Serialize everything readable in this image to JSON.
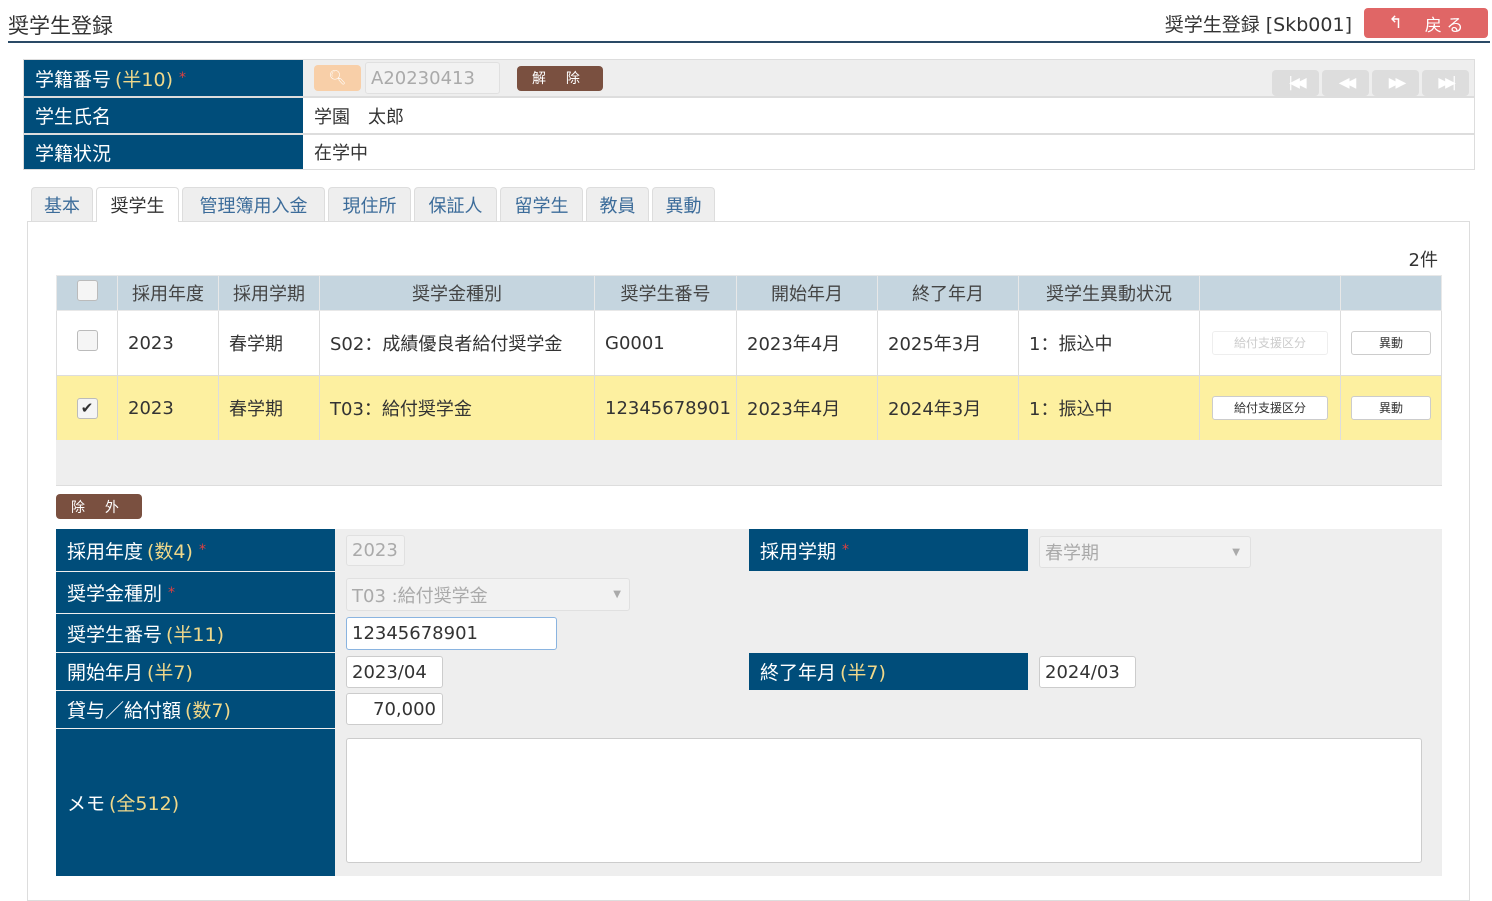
{
  "header": {
    "title": "奨学生登録",
    "screen_id": "奨学生登録 [Skb001]",
    "back_label": "戻 る"
  },
  "student": {
    "id_label": "学籍番号",
    "id_hint": "(半10)",
    "required_mark": "*",
    "id_value": "A20230413",
    "release_label": "解 除",
    "name_label": "学生氏名",
    "name_value": "学園　太郎",
    "status_label": "学籍状況",
    "status_value": "在学中"
  },
  "tabs": [
    "基本",
    "奨学生",
    "管理簿用入金",
    "現住所",
    "保証人",
    "留学生",
    "教員",
    "異動"
  ],
  "list": {
    "count": "2件",
    "headers": [
      "採用年度",
      "採用学期",
      "奨学金種別",
      "奨学生番号",
      "開始年月",
      "終了年月",
      "奨学生異動状況"
    ],
    "rows": [
      {
        "year": "2023",
        "term": "春学期",
        "type": "S02：成績優良者給付奨学金",
        "number": "G0001",
        "start": "2023年4月",
        "end": "2025年3月",
        "status": "1：振込中",
        "support": "給付支援区分",
        "move": "異動",
        "checked": false
      },
      {
        "year": "2023",
        "term": "春学期",
        "type": "T03：給付奨学金",
        "number": "12345678901",
        "start": "2023年4月",
        "end": "2024年3月",
        "status": "1：振込中",
        "support": "給付支援区分",
        "move": "異動",
        "checked": true
      }
    ]
  },
  "exclude_label": "除 外",
  "form": {
    "year_label": "採用年度",
    "year_hint": "(数4)",
    "year_value": "2023",
    "term_label": "採用学期",
    "term_value": "春学期",
    "type_label": "奨学金種別",
    "type_value": "T03 :給付奨学金",
    "number_label": "奨学生番号",
    "number_hint": "(半11)",
    "number_value": "12345678901",
    "start_label": "開始年月",
    "start_hint": "(半7)",
    "start_value": "2023/04",
    "end_label": "終了年月",
    "end_hint": "(半7)",
    "end_value": "2024/03",
    "amount_label": "貸与／給付額",
    "amount_hint": "(数7)",
    "amount_value": "70,000",
    "memo_label": "メモ",
    "memo_hint": "(全512)",
    "memo_value": ""
  }
}
